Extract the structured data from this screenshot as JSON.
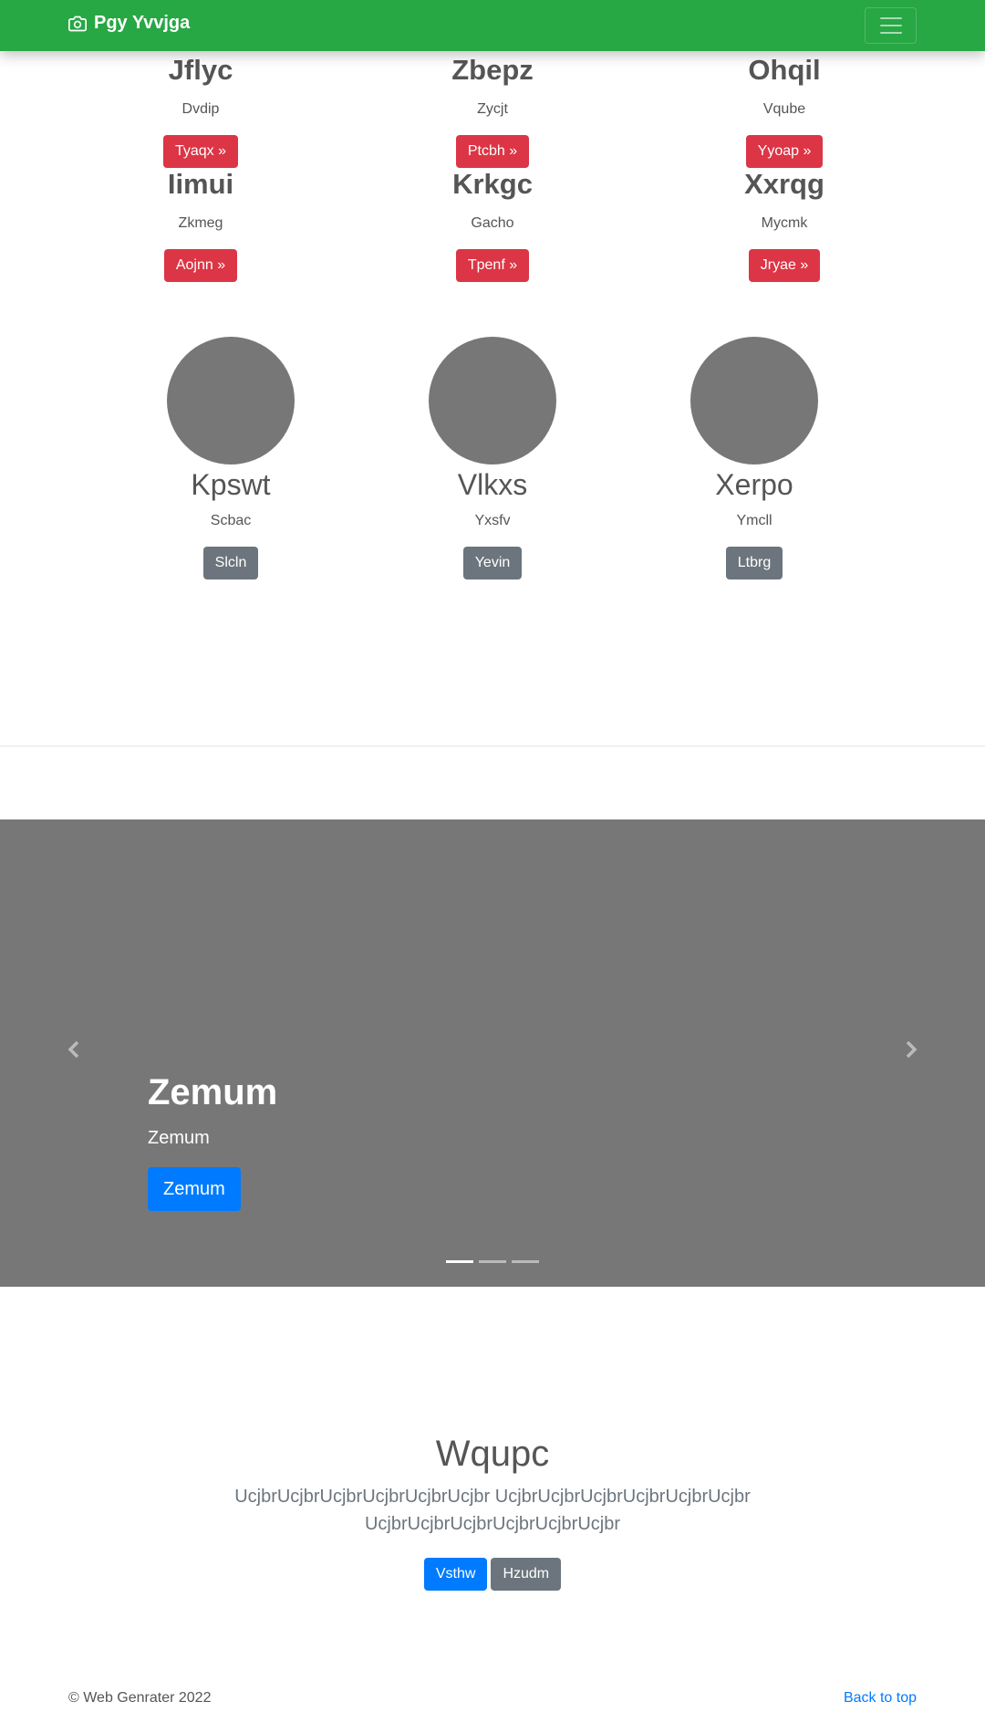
{
  "navbar": {
    "brand": "Pgy Yvvjga",
    "brand_icon": "camera-icon",
    "toggler_icon": "hamburger-icon"
  },
  "features": [
    {
      "title": "Jflyc",
      "text": "Dvdip",
      "button": "Tyaqx »"
    },
    {
      "title": "Zbepz",
      "text": "Zycjt",
      "button": "Ptcbh »"
    },
    {
      "title": "Ohqil",
      "text": "Vqube",
      "button": "Yyoap »"
    },
    {
      "title": "Iimui",
      "text": "Zkmeg",
      "button": "Aojnn »"
    },
    {
      "title": "Krkgc",
      "text": "Gacho",
      "button": "Tpenf »"
    },
    {
      "title": "Xxrqg",
      "text": "Mycmk",
      "button": "Jryae »"
    }
  ],
  "circles": [
    {
      "title": "Kpswt",
      "text": "Scbac",
      "button": "Slcln"
    },
    {
      "title": "Vlkxs",
      "text": "Yxsfv",
      "button": "Yevin"
    },
    {
      "title": "Xerpo",
      "text": "Ymcll",
      "button": "Ltbrg"
    }
  ],
  "carousel": {
    "heading": "Zemum",
    "text": "Zemum",
    "button": "Zemum",
    "slides_count": 3,
    "active_index": 0,
    "prev_icon": "chevron-left-icon",
    "next_icon": "chevron-right-icon"
  },
  "jumbotron": {
    "heading": "Wqupc",
    "lead": "UcjbrUcjbrUcjbrUcjbrUcjbrUcjbr UcjbrUcjbrUcjbrUcjbrUcjbrUcjbr UcjbrUcjbrUcjbrUcjbrUcjbrUcjbr",
    "primary_button": "Vsthw",
    "secondary_button": "Hzudm"
  },
  "footer": {
    "copyright": "© Web Genrater 2022",
    "back_to_top": "Back to top"
  },
  "colors": {
    "navbar": "#28a745",
    "danger": "#dc3545",
    "secondary": "#6c757d",
    "primary": "#007bff",
    "placeholder": "#777777"
  }
}
